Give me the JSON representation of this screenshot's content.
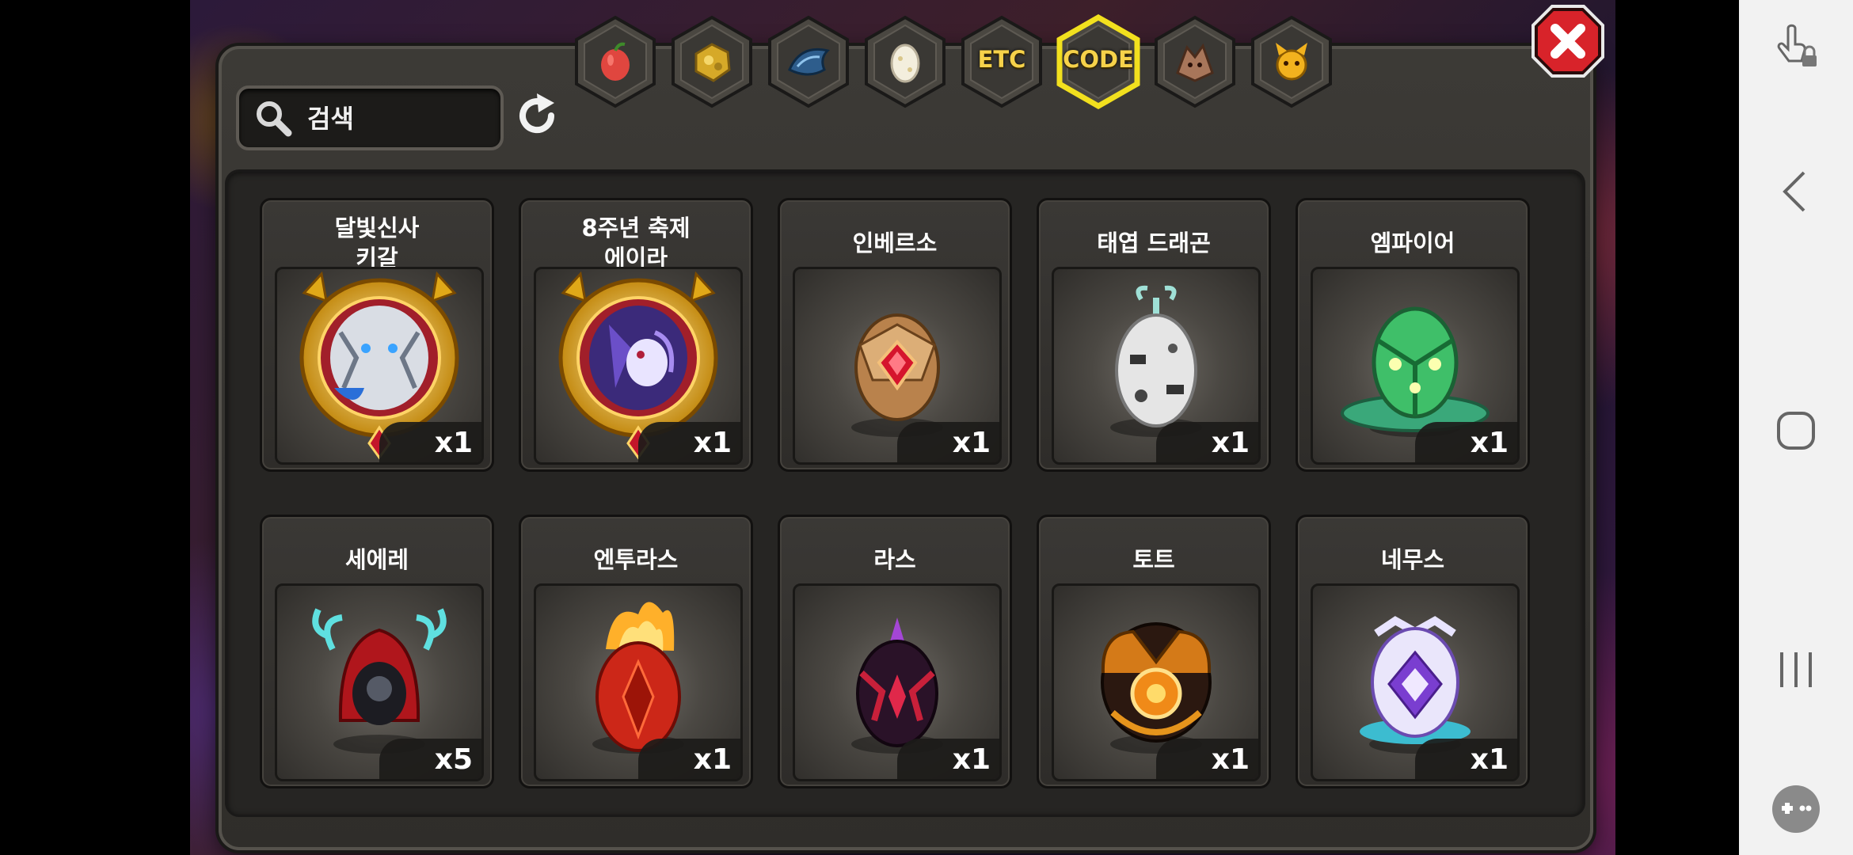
{
  "search": {
    "placeholder": "검색",
    "value": ""
  },
  "tabs": [
    {
      "name": "fruit",
      "label": "",
      "icon": "fruit-icon",
      "selected": false
    },
    {
      "name": "gold-ore",
      "label": "",
      "icon": "gold-ore-icon",
      "selected": false
    },
    {
      "name": "dragon-scale",
      "label": "",
      "icon": "dragon-scale-icon",
      "selected": false
    },
    {
      "name": "egg",
      "label": "",
      "icon": "egg-icon",
      "selected": false
    },
    {
      "name": "etc",
      "label": "ETC",
      "icon": "",
      "selected": false
    },
    {
      "name": "code",
      "label": "CODE",
      "icon": "",
      "selected": true
    },
    {
      "name": "dragon",
      "label": "",
      "icon": "dragon-head-icon",
      "selected": false
    },
    {
      "name": "pet",
      "label": "",
      "icon": "pet-icon",
      "selected": false
    }
  ],
  "items": [
    {
      "name": "달빛신사\n키갈",
      "qty": "x1",
      "art": "medal-white-dragon"
    },
    {
      "name": "8주년 축제\n에이라",
      "qty": "x1",
      "art": "medal-purple-dragon"
    },
    {
      "name": "인베르소",
      "qty": "x1",
      "art": "egg-gold-red"
    },
    {
      "name": "태엽 드래곤",
      "qty": "x1",
      "art": "egg-clockwork"
    },
    {
      "name": "엠파이어",
      "qty": "x1",
      "art": "egg-green"
    },
    {
      "name": "세에레",
      "qty": "x5",
      "art": "egg-red-hood"
    },
    {
      "name": "엔투라스",
      "qty": "x1",
      "art": "egg-flame"
    },
    {
      "name": "라스",
      "qty": "x1",
      "art": "egg-dark-crystal"
    },
    {
      "name": "토트",
      "qty": "x1",
      "art": "egg-orange-dark"
    },
    {
      "name": "네무스",
      "qty": "x1",
      "art": "egg-white-purple"
    }
  ],
  "colors": {
    "accent_selected": "#f2e01e",
    "close_red": "#d8232a",
    "tab_text": "#f6d24a"
  },
  "system_nav": [
    "touch-lock-icon",
    "back-icon",
    "home-icon",
    "recents-icon",
    "game-tools-icon"
  ]
}
